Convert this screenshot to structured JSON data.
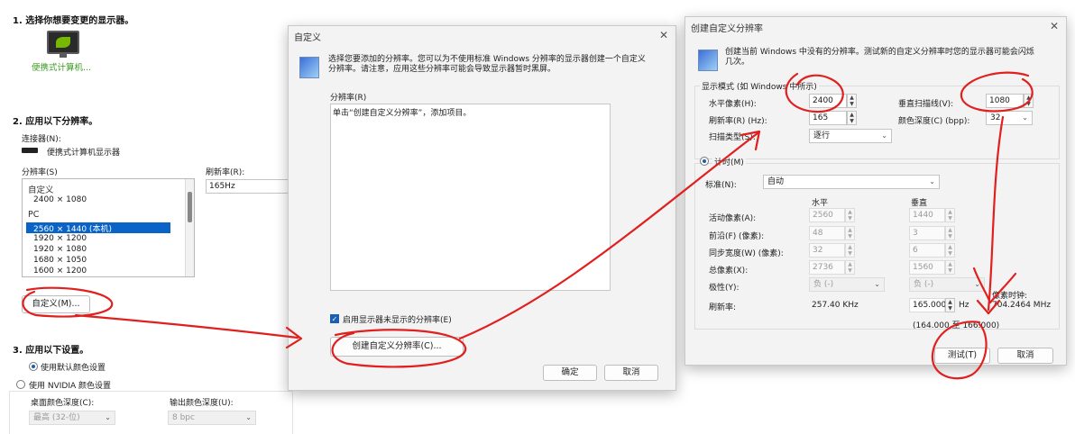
{
  "background": {
    "step1_title": "1. 选择你想要变更的显示器。",
    "monitor_label": "便携式计算机...",
    "step2_title": "2. 应用以下分辨率。",
    "connector_label": "连接器(N):",
    "connector_value": "便携式计算机显示器",
    "resolution_label": "分辨率(S)",
    "refresh_label": "刷新率(R):",
    "refresh_value": "165Hz",
    "list_items": [
      {
        "text": "自定义",
        "group": true
      },
      {
        "text": "2400 × 1080",
        "group": false
      },
      {
        "text": "PC",
        "group": true
      },
      {
        "text": "2560 × 1440 (本机)",
        "group": false,
        "selected": true
      },
      {
        "text": "1920 × 1200",
        "group": false
      },
      {
        "text": "1920 × 1080",
        "group": false
      },
      {
        "text": "1680 × 1050",
        "group": false
      },
      {
        "text": "1600 × 1200",
        "group": false
      }
    ],
    "custom_button": "自定义(M)...",
    "step3_title": "3. 应用以下设置。",
    "radio_default_color": "使用默认颜色设置",
    "radio_nvidia_color": "使用 NVIDIA 颜色设置",
    "desktop_depth_label": "桌面颜色深度(C):",
    "desktop_depth_value": "最高 (32-位)",
    "output_depth_label": "输出颜色深度(U):",
    "output_depth_value": "8 bpc"
  },
  "custom_dialog": {
    "title": "自定义",
    "description": "选择您要添加的分辨率。您可以为不使用标准 Windows 分辨率的显示器创建一个自定义分辨率。请注意，应用这些分辨率可能会导致显示器暂时黑屏。",
    "resolution_label": "分辨率(R)",
    "list_hint": "单击“创建自定义分辨率”，添加项目。",
    "checkbox_label": "启用显示器未显示的分辨率(E)",
    "create_button": "创建自定义分辨率(C)...",
    "ok_button": "确定",
    "cancel_button": "取消"
  },
  "create_dialog": {
    "title": "创建自定义分辨率",
    "description": "创建当前 Windows 中没有的分辨率。测试新的自定义分辨率时您的显示器可能会闪烁几次。",
    "display_mode_label": "显示模式 (如 Windows 中所示)",
    "h_pixels_label": "水平像素(H):",
    "h_pixels_value": "2400",
    "v_lines_label": "垂直扫描线(V):",
    "v_lines_value": "1080",
    "refresh_label": "刷新率(R) (Hz):",
    "refresh_value": "165",
    "color_depth_label": "颜色深度(C) (bpp):",
    "color_depth_value": "32",
    "scan_type_label": "扫描类型(S):",
    "scan_type_value": "逐行",
    "timing_label": "计时(M)",
    "standard_label": "标准(N):",
    "standard_value": "自动",
    "col_horizontal": "水平",
    "col_vertical": "垂直",
    "active_pixels_label": "活动像素(A):",
    "active_h": "2560",
    "active_v": "1440",
    "front_porch_label": "前沿(F) (像素):",
    "front_h": "48",
    "front_v": "3",
    "sync_width_label": "同步宽度(W) (像素):",
    "sync_h": "32",
    "sync_v": "6",
    "total_pixels_label": "总像素(X):",
    "total_h": "2736",
    "total_v": "1560",
    "polarity_label": "极性(Y):",
    "polarity_h": "负 (-)",
    "polarity_v": "负 (-)",
    "pixel_clock_label": "像素时钟:",
    "refresh_rate_label": "刷新率:",
    "refresh_khz": "257.40 KHz",
    "refresh_hz_value": "165.000",
    "hz_unit": "Hz",
    "pixel_clock_value": "704.2464 MHz",
    "range_text": "(164.000 至 166.000)",
    "test_button": "测试(T)",
    "cancel_button": "取消"
  },
  "colors": {
    "accent": "#1a5fb4",
    "selection": "#0a64c8",
    "annotation_red": "#e0201e",
    "nvidia_green": "#76b900"
  }
}
